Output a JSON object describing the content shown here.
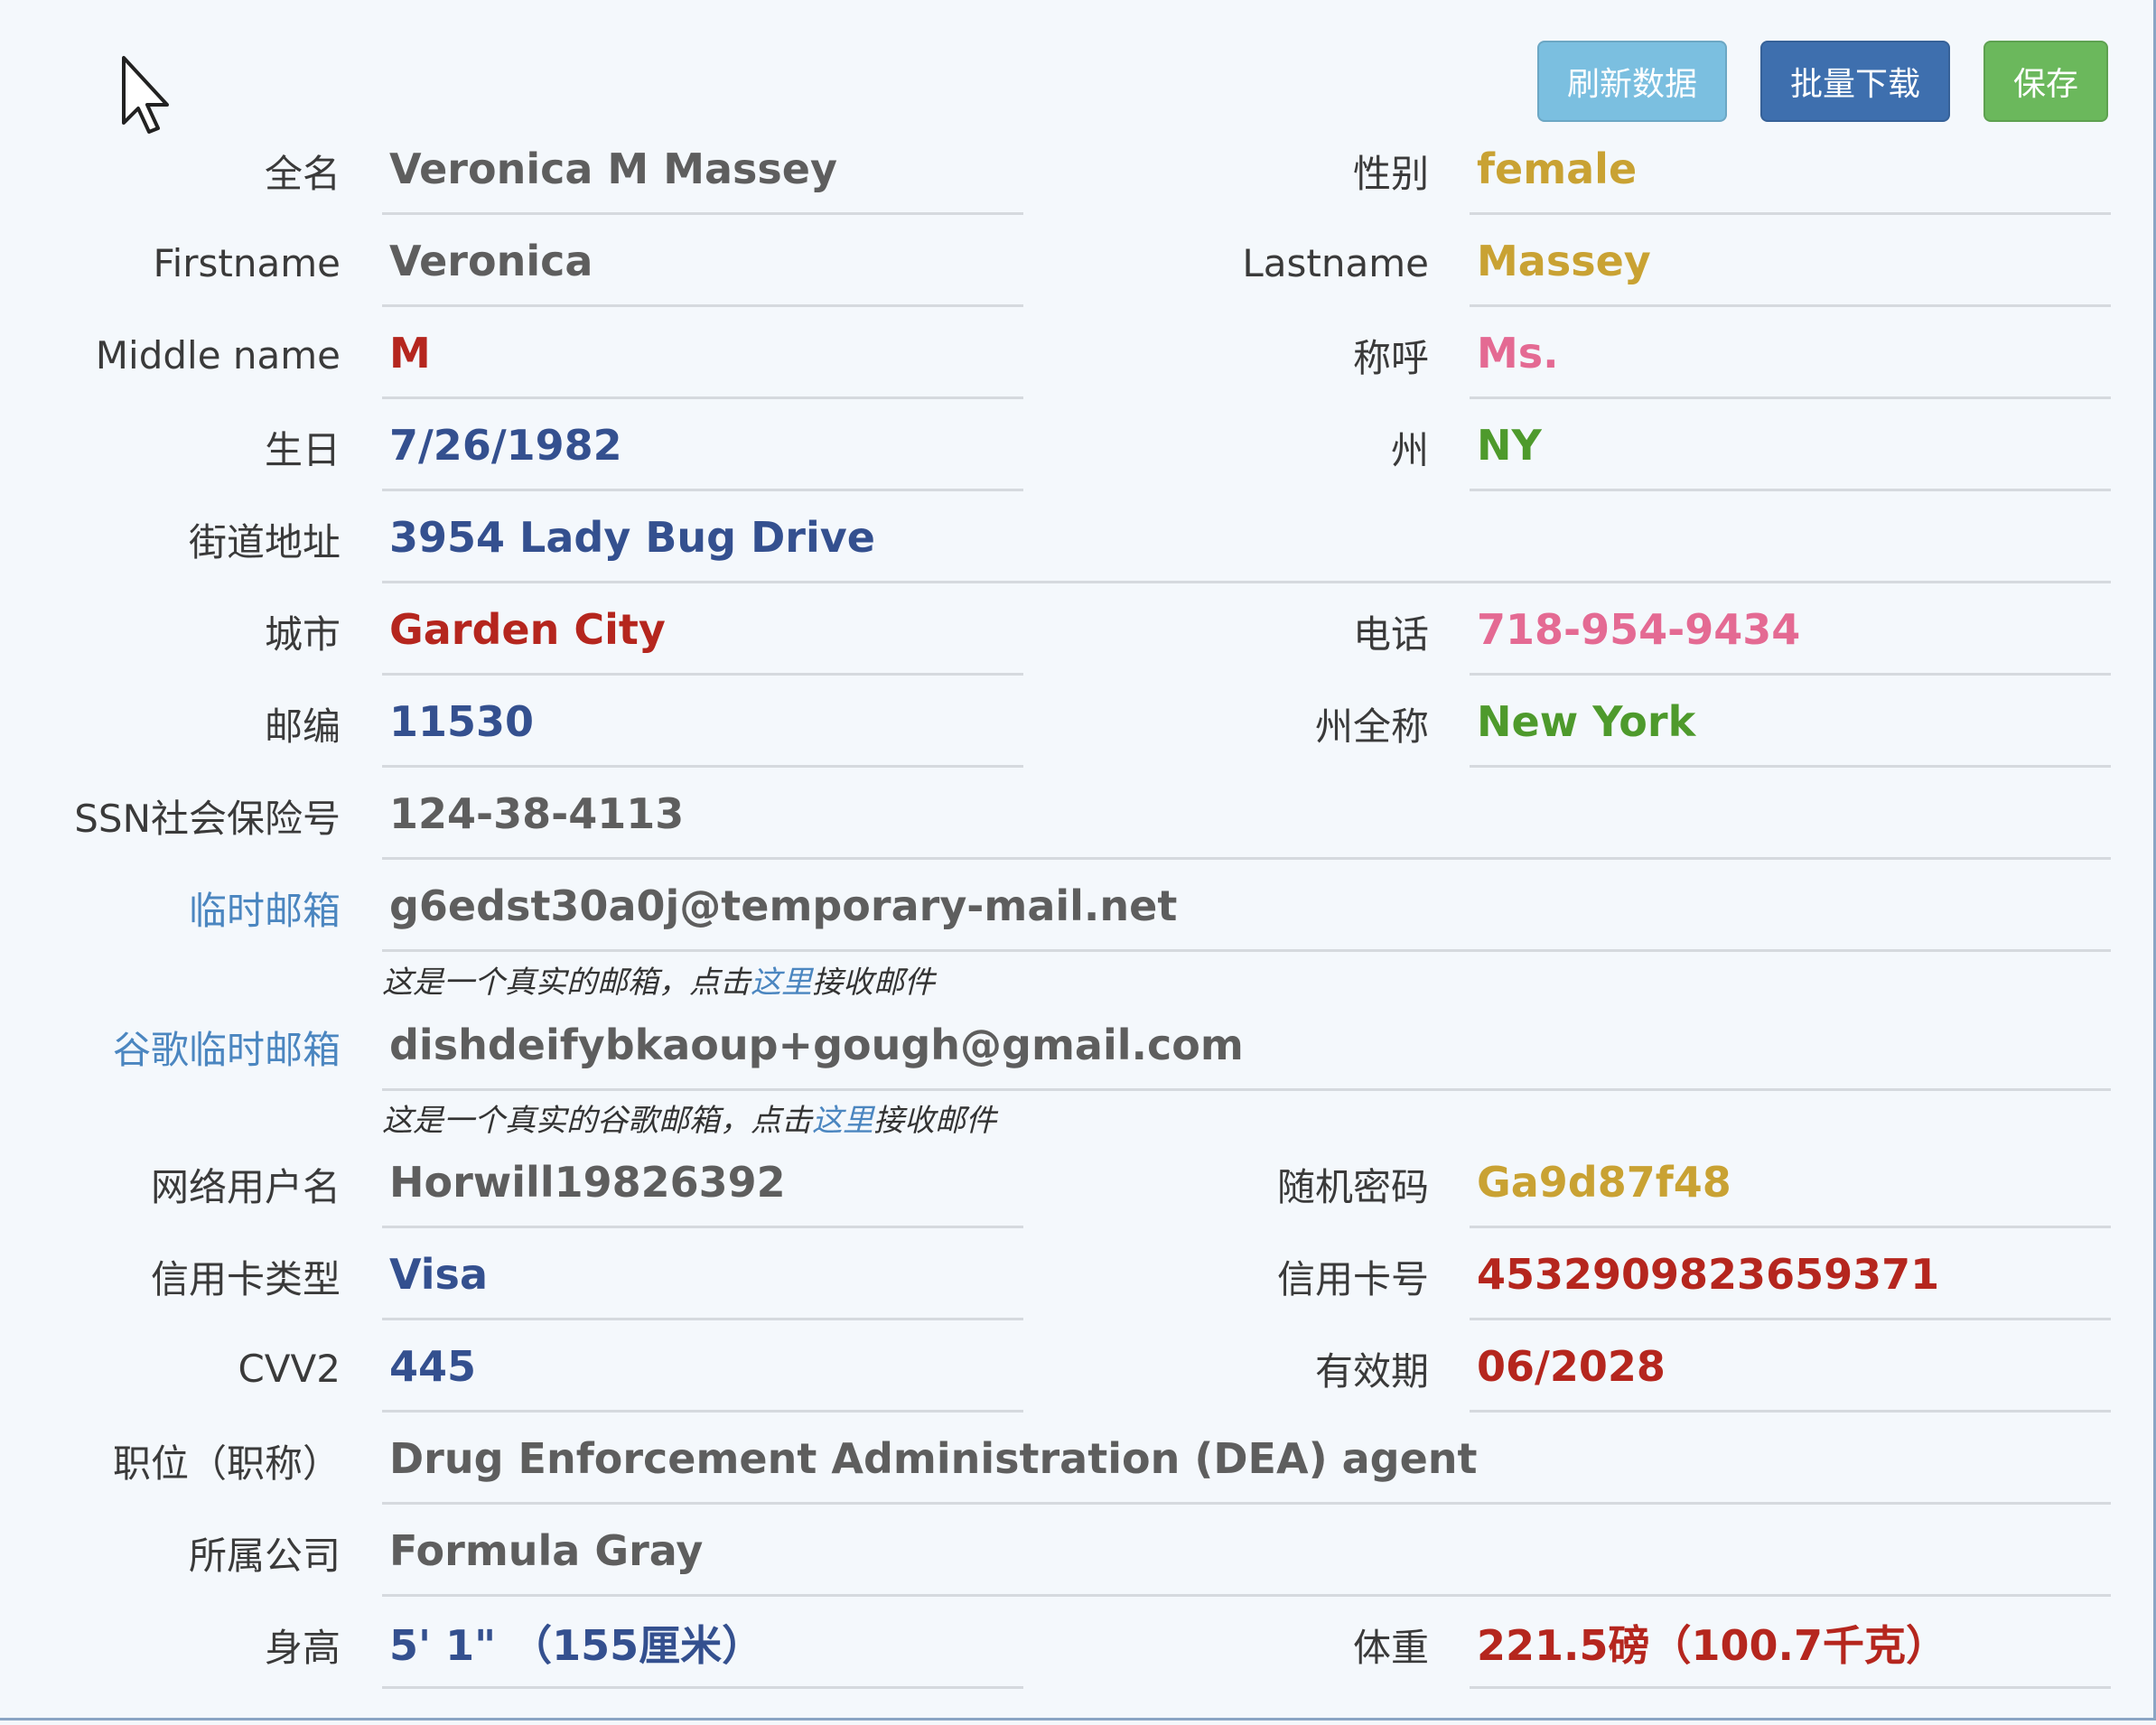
{
  "toolbar": {
    "refresh_label": "刷新数据",
    "download_label": "批量下载",
    "save_label": "保存"
  },
  "profile": {
    "fullname_label": "全名",
    "fullname": "Veronica M Massey",
    "gender_label": "性别",
    "gender": "female",
    "firstname_label": "Firstname",
    "firstname": "Veronica",
    "lastname_label": "Lastname",
    "lastname": "Massey",
    "middlename_label": "Middle name",
    "middlename": "M",
    "title_label": "称呼",
    "title": "Ms.",
    "birthday_label": "生日",
    "birthday": "7/26/1982",
    "state_label": "州",
    "state": "NY",
    "street_label": "街道地址",
    "street": "3954 Lady Bug Drive",
    "city_label": "城市",
    "city": "Garden City",
    "phone_label": "电话",
    "phone": "718-954-9434",
    "zip_label": "邮编",
    "zip": "11530",
    "state_full_label": "州全称",
    "state_full": "New York",
    "ssn_label": "SSN社会保险号",
    "ssn": "124-38-4113",
    "temp_email_label": "临时邮箱",
    "temp_email": "g6edst30a0j@temporary-mail.net",
    "temp_email_note_pre": "这是一个真实的邮箱，点击",
    "temp_email_note_link": "这里",
    "temp_email_note_post": "接收邮件",
    "gmail_label": "谷歌临时邮箱",
    "gmail": "dishdeifybkaoup+gough@gmail.com",
    "gmail_note_pre": "这是一个真实的谷歌邮箱，点击",
    "gmail_note_link": "这里",
    "gmail_note_post": "接收邮件",
    "username_label": "网络用户名",
    "username": "Horwill19826392",
    "password_label": "随机密码",
    "password": "Ga9d87f48",
    "card_type_label": "信用卡类型",
    "card_type": "Visa",
    "card_number_label": "信用卡号",
    "card_number": "4532909823659371",
    "cvv_label": "CVV2",
    "cvv": "445",
    "expiry_label": "有效期",
    "expiry": "06/2028",
    "job_label": "职位（职称）",
    "job": "Drug Enforcement Administration (DEA) agent",
    "company_label": "所属公司",
    "company": "Formula Gray",
    "height_label": "身高",
    "height": "5' 1\" （155厘米）",
    "weight_label": "体重",
    "weight": "221.5磅（100.7千克）"
  }
}
